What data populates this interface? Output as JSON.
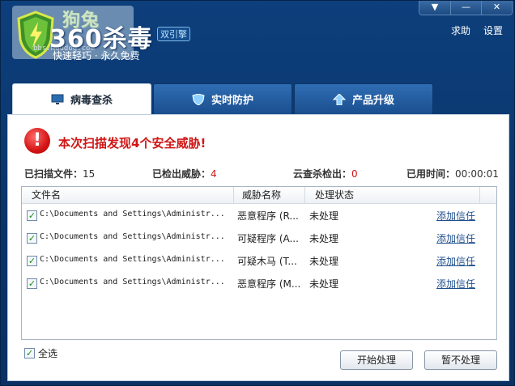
{
  "app": {
    "brand": "360杀毒",
    "engine_badge": "双引擎",
    "slogan": "快速轻巧 · 永久免费",
    "watermark_text": "狗兔",
    "watermark_url": "bbs.maudog.com"
  },
  "window_controls": [
    "▼",
    "—",
    "✕"
  ],
  "top_links": {
    "help": "求助",
    "settings": "设置"
  },
  "tabs": [
    {
      "label": "病毒查杀",
      "icon": "monitor-icon",
      "active": true
    },
    {
      "label": "实时防护",
      "icon": "shield-icon",
      "active": false
    },
    {
      "label": "产品升级",
      "icon": "arrow-up-icon",
      "active": false
    }
  ],
  "alert": {
    "message": "本次扫描发现4个安全威胁!"
  },
  "stats": {
    "scanned_label": "已扫描文件：",
    "scanned_value": "15",
    "detected_label": "已检出威胁：",
    "detected_value": "4",
    "cloud_label": "云查杀检出：",
    "cloud_value": "0",
    "time_label": "已用时间：",
    "time_value": "00:00:01"
  },
  "table": {
    "headers": {
      "file": "文件名",
      "threat": "威胁名称",
      "status": "处理状态"
    },
    "rows": [
      {
        "file": "C:\\Documents and Settings\\Administr...",
        "threat": "恶意程序 (R...",
        "status": "未处理",
        "action": "添加信任",
        "checked": true
      },
      {
        "file": "C:\\Documents and Settings\\Administr...",
        "threat": "可疑程序 (A...",
        "status": "未处理",
        "action": "添加信任",
        "checked": true
      },
      {
        "file": "C:\\Documents and Settings\\Administr...",
        "threat": "可疑木马 (T...",
        "status": "未处理",
        "action": "添加信任",
        "checked": true
      },
      {
        "file": "C:\\Documents and Settings\\Administr...",
        "threat": "恶意程序 (M...",
        "status": "未处理",
        "action": "添加信任",
        "checked": true
      }
    ]
  },
  "footer": {
    "select_all": "全选",
    "start_button": "开始处理",
    "skip_button": "暂不处理"
  },
  "colors": {
    "accent": "#0b3d75",
    "alert": "#d01616",
    "link": "#1f4f8c"
  }
}
